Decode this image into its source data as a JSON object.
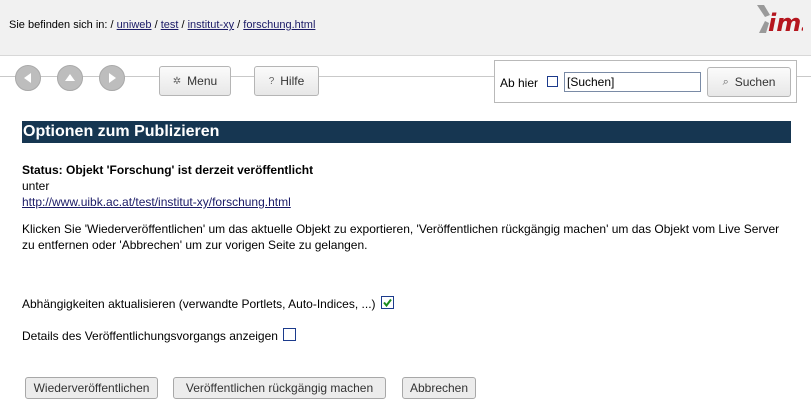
{
  "breadcrumb": {
    "prefix": "Sie befinden sich in: /",
    "items": [
      "uniweb",
      "test",
      "institut-xy",
      "forschung.html"
    ]
  },
  "logo": {
    "text": "ims",
    "color": "#b5161e"
  },
  "toolbar": {
    "back_icon": "arrow-left-icon",
    "up_icon": "arrow-up-icon",
    "forward_icon": "arrow-right-icon",
    "menu_label": "Menu",
    "help_label": "Hilfe"
  },
  "search": {
    "scope_label": "Ab hier",
    "input_value": "[Suchen]",
    "button_label": "Suchen"
  },
  "main": {
    "title": "Optionen zum Publizieren",
    "status": "Status: Objekt 'Forschung' ist derzeit veröffentlicht",
    "under": "unter",
    "url": "http://www.uibk.ac.at/test/institut-xy/forschung.html",
    "instructions": "Klicken Sie  'Wiederveröffentlichen'  um das aktuelle Objekt zu exportieren, 'Veröffentlichen rückgängig machen' um das Objekt vom Live Server zu entfernen oder 'Abbrechen' um zur vorigen Seite zu gelangen.",
    "option_dependencies": "Abhängigkeiten aktualisieren (verwandte Portlets, Auto-Indices, ...)",
    "option_dependencies_checked": true,
    "option_details": "Details des Veröffentlichungsvorgangs anzeigen",
    "option_details_checked": false
  },
  "buttons": {
    "republish": "Wiederveröffentlichen",
    "unpublish": "Veröffentlichen rückgängig machen",
    "cancel": "Abbrechen"
  },
  "colors": {
    "title_bar": "#163651",
    "link": "#1a1a66",
    "check": "#1c8c1c"
  }
}
